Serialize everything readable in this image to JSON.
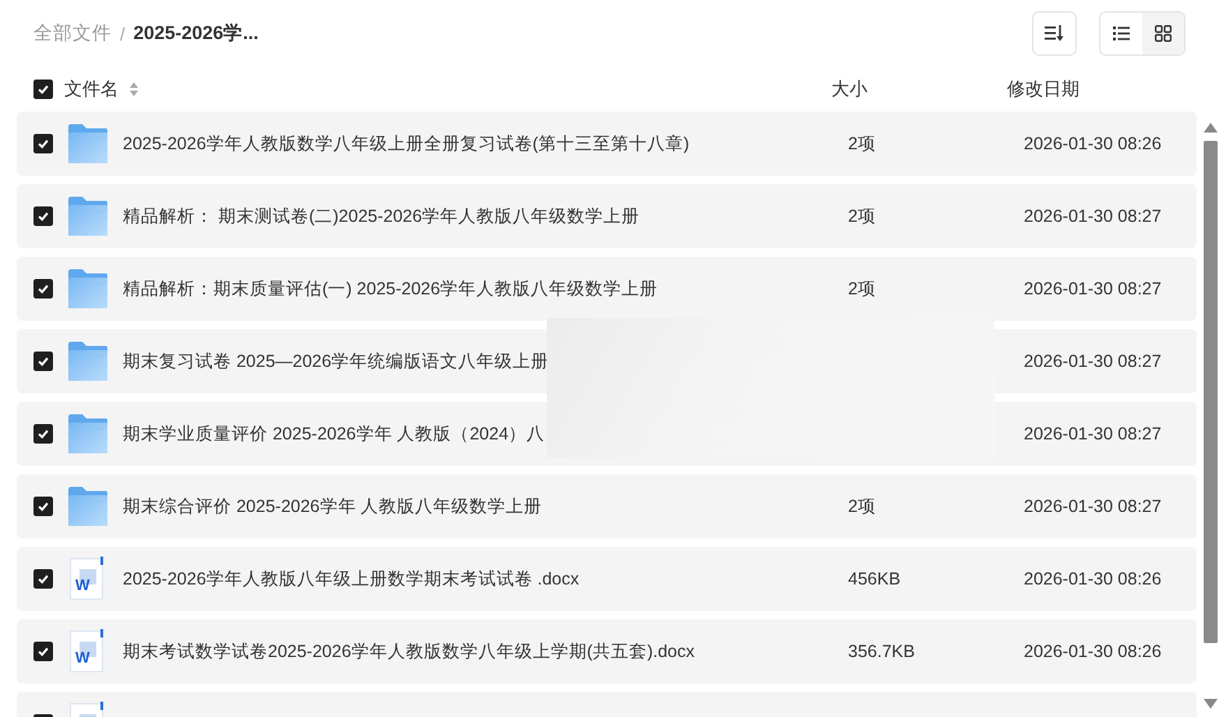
{
  "breadcrumb": {
    "separator": "/",
    "items": [
      {
        "label": "全部文件",
        "current": false
      },
      {
        "label": "2025-2026学...",
        "current": true
      }
    ]
  },
  "toolbar": {
    "views": [
      {
        "kind": "list",
        "selected": true
      },
      {
        "kind": "grid",
        "selected": false
      }
    ]
  },
  "table": {
    "select_all": {
      "checked": true
    },
    "columns": [
      {
        "label": "文件名",
        "sortable": true
      },
      {
        "label": "大小"
      },
      {
        "label": "修改日期"
      }
    ],
    "rows": [
      {
        "kind": "folder",
        "checked": true,
        "name": "2025-2026学年人教版数学八年级上册全册复习试卷(第十三至第十八章)",
        "size": "2项",
        "date": "2026-01-30 08:26"
      },
      {
        "kind": "folder",
        "checked": true,
        "name": "精品解析： 期末测试卷(二)2025-2026学年人教版八年级数学上册",
        "size": "2项",
        "date": "2026-01-30 08:27"
      },
      {
        "kind": "folder",
        "checked": true,
        "name": "精品解析：期末质量评估(一) 2025-2026学年人教版八年级数学上册",
        "size": "2项",
        "date": "2026-01-30 08:27"
      },
      {
        "kind": "folder",
        "checked": true,
        "name": "期末复习试卷 2025—2026学年统编版语文八年级上册",
        "date": "2026-01-30 08:27"
      },
      {
        "kind": "folder",
        "checked": true,
        "name": "期末学业质量评价 2025-2026学年 人教版（2024）八",
        "date": "2026-01-30 08:27"
      },
      {
        "kind": "folder",
        "checked": true,
        "name": "期末综合评价 2025-2026学年 人教版八年级数学上册",
        "size": "2项",
        "date": "2026-01-30 08:27"
      },
      {
        "kind": "doc",
        "badge": "W",
        "checked": true,
        "name": "2025-2026学年人教版八年级上册数学期末考试试卷 .docx",
        "size": "456KB",
        "date": "2026-01-30 08:26"
      },
      {
        "kind": "doc",
        "badge": "W",
        "checked": true,
        "name": "期末考试数学试卷2025-2026学年人教版数学八年级上学期(共五套).docx",
        "size": "356.7KB",
        "date": "2026-01-30 08:26"
      },
      {
        "kind": "doc",
        "checked": true
      }
    ]
  }
}
